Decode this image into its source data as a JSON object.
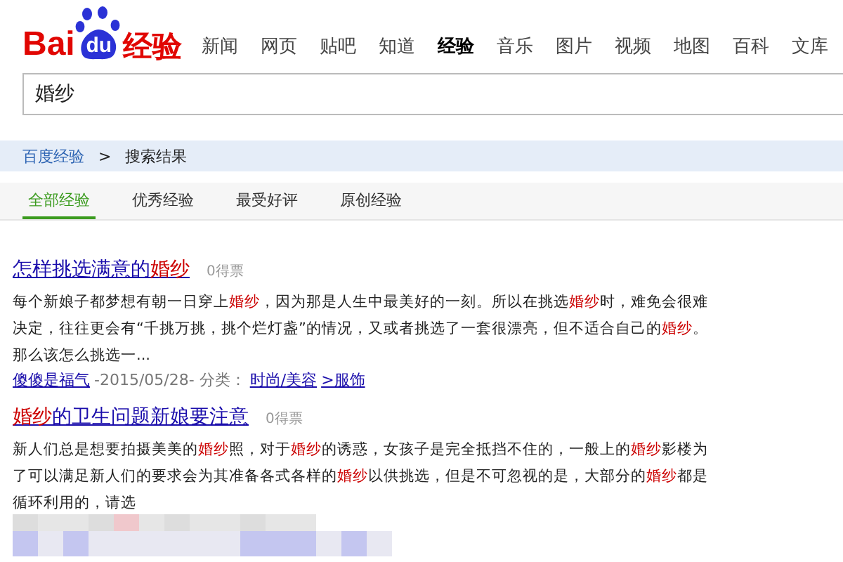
{
  "logo": {
    "brand_a": "Bai",
    "brand_b": "du",
    "product": "经验"
  },
  "nav": [
    {
      "label": "新闻",
      "selected": false
    },
    {
      "label": "网页",
      "selected": false
    },
    {
      "label": "贴吧",
      "selected": false
    },
    {
      "label": "知道",
      "selected": false
    },
    {
      "label": "经验",
      "selected": true
    },
    {
      "label": "音乐",
      "selected": false
    },
    {
      "label": "图片",
      "selected": false
    },
    {
      "label": "视频",
      "selected": false
    },
    {
      "label": "地图",
      "selected": false
    },
    {
      "label": "百科",
      "selected": false
    },
    {
      "label": "文库",
      "selected": false
    }
  ],
  "search": {
    "value": "婚纱"
  },
  "breadcrumb": {
    "home": "百度经验",
    "separator": ">",
    "current": "搜索结果"
  },
  "tabs": [
    {
      "label": "全部经验",
      "selected": true
    },
    {
      "label": "优秀经验",
      "selected": false
    },
    {
      "label": "最受好评",
      "selected": false
    },
    {
      "label": "原创经验",
      "selected": false
    }
  ],
  "results": [
    {
      "title": [
        {
          "text": "怎样挑选满意的",
          "highlight": false
        },
        {
          "text": "婚纱",
          "highlight": true
        }
      ],
      "votes": "0得票",
      "snippet": [
        {
          "text": "每个新娘子都梦想有朝一日穿上",
          "highlight": false
        },
        {
          "text": "婚纱",
          "highlight": true
        },
        {
          "text": "，因为那是人生中最美好的一刻。所以在挑选",
          "highlight": false
        },
        {
          "text": "婚纱",
          "highlight": true
        },
        {
          "text": "时，难免会很难决定，往往更会有“千挑万挑，挑个烂灯盏”的情况，又或者挑选了一套很漂亮，但不适合自己的",
          "highlight": false
        },
        {
          "text": "婚纱",
          "highlight": true
        },
        {
          "text": "。那么该怎么挑选一...",
          "highlight": false
        }
      ],
      "author": "傻傻是福气",
      "date": "-2015/05/28- 分类：",
      "category": "时尚/美容",
      "subcategory": ">服饰"
    },
    {
      "title": [
        {
          "text": "婚纱",
          "highlight": true
        },
        {
          "text": "的卫生问题新娘要注意",
          "highlight": false
        }
      ],
      "votes": "0得票",
      "snippet": [
        {
          "text": "新人们总是想要拍摄美美的",
          "highlight": false
        },
        {
          "text": "婚纱",
          "highlight": true
        },
        {
          "text": "照，对于",
          "highlight": false
        },
        {
          "text": "婚纱",
          "highlight": true
        },
        {
          "text": "的诱惑，女孩子是完全抵挡不住的，一般上的",
          "highlight": false
        },
        {
          "text": "婚纱",
          "highlight": true
        },
        {
          "text": "影楼为了可以满足新人们的要求会为其准备各式各样的",
          "highlight": false
        },
        {
          "text": "婚纱",
          "highlight": true
        },
        {
          "text": "以供挑选，但是不可忽视的是，大部分的",
          "highlight": false
        },
        {
          "text": "婚纱",
          "highlight": true
        },
        {
          "text": "都是循环利用的，请选",
          "highlight": false
        }
      ]
    }
  ]
}
